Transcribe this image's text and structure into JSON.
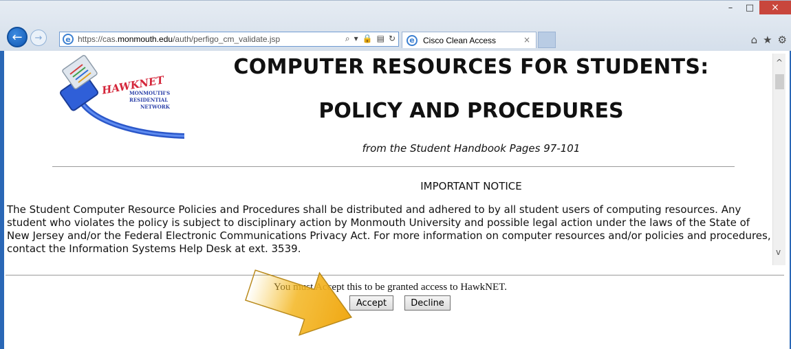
{
  "browser": {
    "url_prefix": "https://cas.",
    "url_host": "monmouth.edu",
    "url_path": "/auth/perfigo_cm_validate.jsp",
    "tab_title": "Cisco Clean Access",
    "tab_close_glyph": "×",
    "window_controls": {
      "minimize": "–",
      "maximize": "□",
      "close": "×"
    },
    "toolbar_icons": [
      "home-icon",
      "star-icon",
      "gear-icon"
    ],
    "address_tools": [
      "search-icon",
      "lock-icon",
      "compat-icon",
      "refresh-icon"
    ]
  },
  "logo": {
    "brand": "HAWKNET",
    "line1": "MONMOUTH'S",
    "line2": "RESIDENTIAL",
    "line3": "NETWORK"
  },
  "page": {
    "heading_line1": "COMPUTER RESOURCES FOR STUDENTS:",
    "heading_line2": "POLICY AND PROCEDURES",
    "subtitle": "from the Student Handbook Pages 97-101",
    "notice_title": "IMPORTANT NOTICE",
    "notice_body": "The Student Computer Resource Policies and Procedures shall be distributed and adhered to by all student users of computing resources. Any student who violates the policy is subject to disciplinary action by Monmouth University and possible legal action under the laws of the State of New Jersey and/or the Federal Electronic Communications Privacy Act. For more information on computer resources and/or policies and procedures, contact the Information Systems Help Desk at ext. 3539."
  },
  "accept_section": {
    "message": "You must Accept this to be granted access to HawkNET.",
    "accept_label": "Accept",
    "decline_label": "Decline"
  },
  "colors": {
    "window_accent": "#2a67b6",
    "close_button": "#c8463c",
    "arrow": "#f2b21c"
  }
}
